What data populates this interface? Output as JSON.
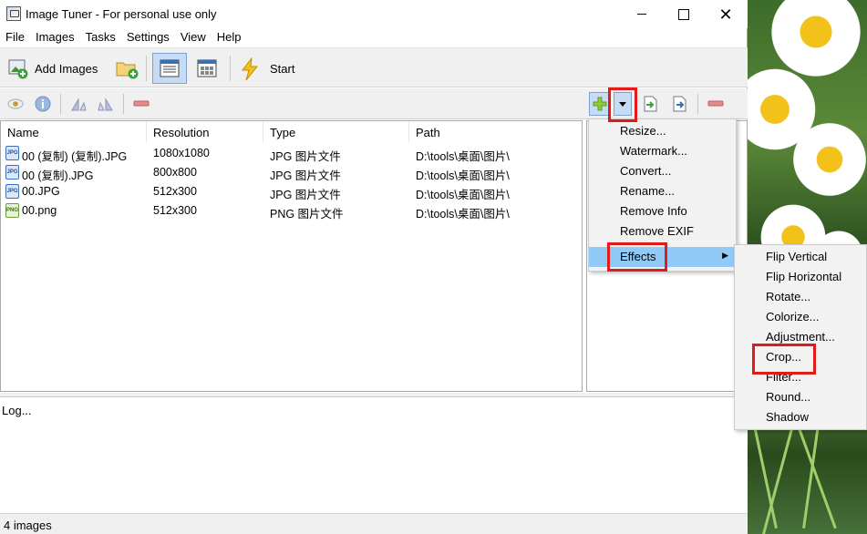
{
  "window": {
    "title": "Image Tuner - For personal use only"
  },
  "menubar": {
    "items": [
      "File",
      "Images",
      "Tasks",
      "Settings",
      "View",
      "Help"
    ]
  },
  "toolbar": {
    "add_images_label": "Add Images",
    "start_label": "Start"
  },
  "filelist": {
    "columns": [
      "Name",
      "Resolution",
      "Type",
      "Path"
    ],
    "rows": [
      {
        "icon": "JPG",
        "name": "00 (复制) (复制).JPG",
        "resolution": "1080x1080",
        "type": "JPG 图片文件",
        "path": "D:\\tools\\桌面\\图片\\"
      },
      {
        "icon": "JPG",
        "name": "00 (复制).JPG",
        "resolution": "800x800",
        "type": "JPG 图片文件",
        "path": "D:\\tools\\桌面\\图片\\"
      },
      {
        "icon": "JPG",
        "name": "00.JPG",
        "resolution": "512x300",
        "type": "JPG 图片文件",
        "path": "D:\\tools\\桌面\\图片\\"
      },
      {
        "icon": "PNG",
        "name": "00.png",
        "resolution": "512x300",
        "type": "PNG 图片文件",
        "path": "D:\\tools\\桌面\\图片\\"
      }
    ]
  },
  "task_menu": {
    "items": [
      "Resize...",
      "Watermark...",
      "Convert...",
      "Rename...",
      "Remove Info",
      "Remove EXIF",
      "Effects"
    ]
  },
  "effects_menu": {
    "items": [
      "Flip Vertical",
      "Flip Horizontal",
      "Rotate...",
      "Colorize...",
      "Adjustment...",
      "Crop...",
      "Filter...",
      "Round...",
      "Shadow"
    ]
  },
  "log": {
    "text": "Log..."
  },
  "status": {
    "text": "4 images"
  },
  "colors": {
    "highlight": "#91c9f7",
    "annotation_red": "#e21a1a",
    "toggle_active": "#c7dcf4"
  }
}
